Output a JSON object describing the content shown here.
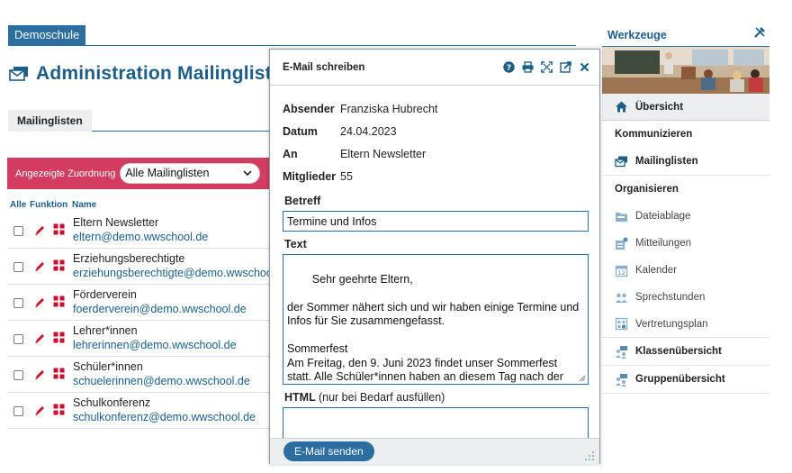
{
  "school": {
    "name": "Demoschule"
  },
  "page": {
    "title": "Administration Mailinglisten"
  },
  "tabs": [
    {
      "label": "Mailinglisten"
    }
  ],
  "filter": {
    "label": "Angezeigte Zuordnung",
    "selected": "Alle Mailinglisten"
  },
  "list": {
    "headers": {
      "all": "Alle",
      "function": "Funktion",
      "name": "Name"
    },
    "rows": [
      {
        "name": "Eltern Newsletter",
        "email": "eltern@demo.wwschool.de"
      },
      {
        "name": "Erziehungsberechtigte",
        "email": "erziehungsberechtigte@demo.wwschool.de"
      },
      {
        "name": "Förderverein",
        "email": "foerderverein@demo.wwschool.de"
      },
      {
        "name": "Lehrer*innen",
        "email": "lehrerinnen@demo.wwschool.de"
      },
      {
        "name": "Schüler*innen",
        "email": "schuelerinnen@demo.wwschool.de"
      },
      {
        "name": "Schulkonferenz",
        "email": "schulkonferenz@demo.wwschool.de"
      }
    ]
  },
  "sidebar": {
    "title": "Werkzeuge",
    "overview": "Übersicht",
    "sections": [
      {
        "title": "Kommunizieren",
        "items": [
          {
            "label": "Mailinglisten",
            "icon": "mail-stack-icon"
          }
        ]
      },
      {
        "title": "Organisieren",
        "items": [
          {
            "label": "Dateiablage",
            "icon": "folder-icon"
          },
          {
            "label": "Mitteilungen",
            "icon": "notice-icon"
          },
          {
            "label": "Kalender",
            "icon": "calendar-icon"
          },
          {
            "label": "Sprechstunden",
            "icon": "people-icon"
          },
          {
            "label": "Vertretungsplan",
            "icon": "schedule-icon"
          }
        ]
      }
    ],
    "bottom_items": [
      {
        "label": "Klassenübersicht",
        "icon": "class-icon"
      },
      {
        "label": "Gruppenübersicht",
        "icon": "group-icon"
      }
    ]
  },
  "dialog": {
    "title": "E-Mail schreiben",
    "meta": [
      {
        "key": "Absender",
        "value": "Franziska Hubrecht"
      },
      {
        "key": "Datum",
        "value": "24.04.2023"
      },
      {
        "key": "An",
        "value": "Eltern Newsletter"
      },
      {
        "key": "Mitglieder",
        "value": "55"
      }
    ],
    "subject_label": "Betreff",
    "subject_value": "Termine und Infos",
    "text_label": "Text",
    "text_value": "Sehr geehrte Eltern,\n\nder Sommer nähert sich und wir haben einige Termine und Infos für Sie zusammengefasst.\n\nSommerfest\nAm Freitag, den 9. Juni 2023 findet unser Sommerfest statt. Alle Schüler*innen haben an diesem Tag nach der zweiten Unterrichtsstunde frei. Wir würden uns über ihr zahlreiches",
    "html_label": "HTML",
    "html_hint": "(nur bei Bedarf ausfüllen)",
    "send_label": "E-Mail senden"
  },
  "colors": {
    "primary": "#2c6ea0",
    "accent": "#d23c5f",
    "title": "#1d5d86"
  }
}
